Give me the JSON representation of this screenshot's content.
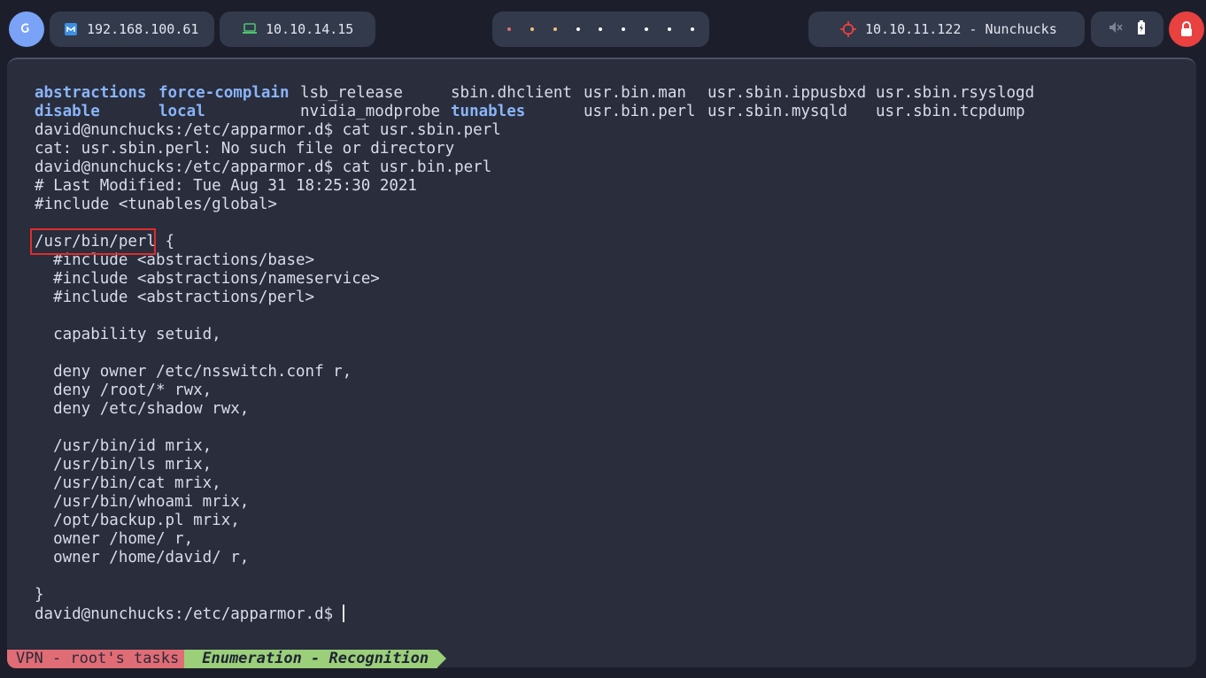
{
  "topbar": {
    "ip_local": "192.168.100.61",
    "ip_vpn": "10.10.14.15",
    "target": "10.10.11.122 - Nunchucks",
    "workspace_dot_colors": [
      "#e06c75",
      "#f0c674",
      "#f0c674",
      "#ffffff",
      "#ffffff",
      "#ffffff",
      "#ffffff",
      "#ffffff",
      "#ffffff"
    ]
  },
  "terminal": {
    "ls_rows": [
      [
        {
          "text": "abstractions",
          "type": "dir"
        },
        {
          "text": "force-complain",
          "type": "dir"
        },
        {
          "text": "lsb_release",
          "type": "file"
        },
        {
          "text": "sbin.dhclient",
          "type": "file"
        },
        {
          "text": "usr.bin.man",
          "type": "file"
        },
        {
          "text": "usr.sbin.ippusbxd",
          "type": "file"
        },
        {
          "text": "usr.sbin.rsyslogd",
          "type": "file"
        }
      ],
      [
        {
          "text": "disable",
          "type": "dir"
        },
        {
          "text": "local",
          "type": "dir"
        },
        {
          "text": "nvidia_modprobe",
          "type": "file"
        },
        {
          "text": "tunables",
          "type": "dir"
        },
        {
          "text": "usr.bin.perl",
          "type": "file"
        },
        {
          "text": "usr.sbin.mysqld",
          "type": "file"
        },
        {
          "text": "usr.sbin.tcpdump",
          "type": "file"
        }
      ]
    ],
    "lines": [
      "david@nunchucks:/etc/apparmor.d$ cat usr.sbin.perl",
      "cat: usr.sbin.perl: No such file or directory",
      "david@nunchucks:/etc/apparmor.d$ cat usr.bin.perl",
      "# Last Modified: Tue Aug 31 18:25:30 2021",
      "#include <tunables/global>",
      "",
      "/usr/bin/perl {",
      "  #include <abstractions/base>",
      "  #include <abstractions/nameservice>",
      "  #include <abstractions/perl>",
      "",
      "  capability setuid,",
      "",
      "  deny owner /etc/nsswitch.conf r,",
      "  deny /root/* rwx,",
      "  deny /etc/shadow rwx,",
      "",
      "  /usr/bin/id mrix,",
      "  /usr/bin/ls mrix,",
      "  /usr/bin/cat mrix,",
      "  /usr/bin/whoami mrix,",
      "  /opt/backup.pl mrix,",
      "  owner /home/ r,",
      "  owner /home/david/ r,",
      "",
      "}"
    ],
    "prompt": "david@nunchucks:/etc/apparmor.d$ "
  },
  "statusbar": {
    "segment1": "VPN - root's tasks",
    "segment2": "Enumeration - Recognition"
  },
  "colors": {
    "terminal_bg": "#292d3c",
    "dir_blue": "#8ab4f8",
    "highlight_red": "#e02c2c"
  }
}
